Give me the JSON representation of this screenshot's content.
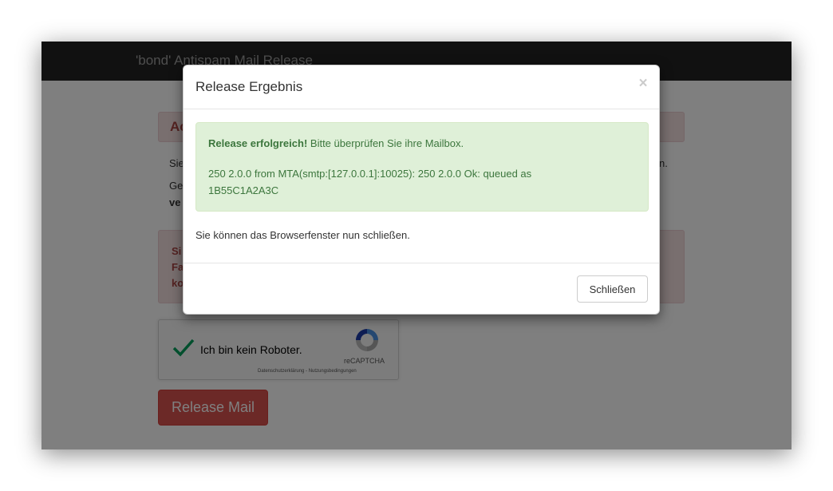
{
  "navbar": {
    "brand": "'bond' Antispam Mail Release"
  },
  "background_page": {
    "alert_heading": "Ac",
    "line1_start": "Sie",
    "line1_end": "n.",
    "line2_start": "Ge",
    "line3_start": "ve",
    "danger_lines": [
      "Si",
      "Fa",
      "ko"
    ]
  },
  "recaptcha": {
    "label": "Ich bin kein Roboter.",
    "brand": "reCAPTCHA",
    "terms": "Datenschutzerklärung - Nutzungsbedingungen"
  },
  "release_button": {
    "label": "Release Mail"
  },
  "modal": {
    "title": "Release Ergebnis",
    "close_symbol": "×",
    "success": {
      "strong": "Release erfolgreich!",
      "text": " Bitte überprüfen Sie ihre Mailbox.",
      "response_line1": "250 2.0.0 from MTA(smtp:[127.0.0.1]:10025): 250 2.0.0 Ok: queued as",
      "response_line2": "1B55C1A2A3C"
    },
    "note": "Sie können das Browserfenster nun schließen.",
    "footer_button": "Schließen"
  },
  "colors": {
    "navbar": "#222222",
    "success_bg": "#dff0d8",
    "success_text": "#3c763d",
    "danger_bg": "#f2dede",
    "danger_text": "#a94442",
    "release_button": "#d9534f"
  }
}
